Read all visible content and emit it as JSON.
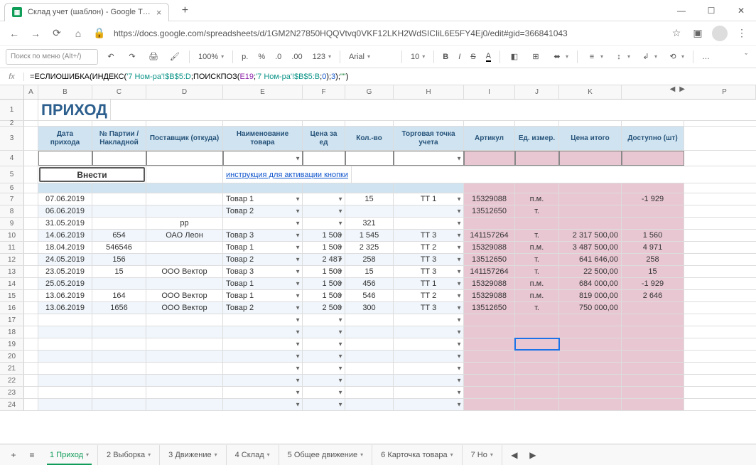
{
  "browser": {
    "tab_title": "Склад учет (шаблон) - Google Т…",
    "url": "https://docs.google.com/spreadsheets/d/1GM2N27850HQQVtvq0VKF12LKH2WdSICIiL6E5FY4Ej0/edit#gid=366841043"
  },
  "toolbar": {
    "search_ph": "Поиск по меню (Alt+/)",
    "zoom": "100%",
    "currency": "р.",
    "percent": "%",
    "dec_dec": ".0",
    "dec_inc": ".00",
    "num_fmt": "123",
    "font": "Arial",
    "font_size": "10"
  },
  "formula": {
    "prefix": "=",
    "fn1": "ЕСЛИОШИБКА",
    "fn2": "ИНДЕКС",
    "range1": "'7 Ном-ра'!$B$5:D",
    "fn3": "ПОИСКПОЗ",
    "ref": "E19",
    "range2": "'7 Ном-ра'!$B$5:B",
    "arg0": "0",
    "arg3": "3",
    "empty": "\"\""
  },
  "sheet": {
    "title": "ПРИХОД",
    "btn_enter": "Внести",
    "instr": "инструкция для активации кнопки",
    "cols": [
      "A",
      "B",
      "C",
      "D",
      "E",
      "F",
      "G",
      "H",
      "I",
      "J",
      "K",
      "P"
    ],
    "headers": {
      "B": "Дата прихода",
      "C": "№ Партии / Накладной",
      "D": "Поставщик (откуда)",
      "E": "Наименование товара",
      "F": "Цена за ед",
      "G": "Кол.-во",
      "H": "Торговая точка учета",
      "I": "Артикул",
      "J": "Ед. измер.",
      "K": "Цена итого",
      "P": "Доступно (шт)"
    },
    "rows": [
      {
        "n": "7",
        "B": "07.06.2019",
        "C": "",
        "D": "",
        "E": "Товар 1",
        "F": "",
        "G": "15",
        "H": "ТТ 1",
        "I": "15329088",
        "J": "п.м.",
        "K": "",
        "P": "-1 929"
      },
      {
        "n": "8",
        "B": "06.06.2019",
        "C": "",
        "D": "",
        "E": "Товар 2",
        "F": "",
        "G": "",
        "H": "",
        "I": "13512650",
        "J": "т.",
        "K": "",
        "P": ""
      },
      {
        "n": "9",
        "B": "31.05.2019",
        "C": "",
        "D": "рр",
        "E": "",
        "F": "",
        "G": "321",
        "H": "",
        "I": "",
        "J": "",
        "K": "",
        "P": ""
      },
      {
        "n": "10",
        "B": "14.06.2019",
        "C": "654",
        "D": "ОАО Леон",
        "E": "Товар 3",
        "F": "1 500",
        "G": "1 545",
        "H": "ТТ 3",
        "I": "141157264",
        "J": "т.",
        "K": "2 317 500,00",
        "P": "1 560"
      },
      {
        "n": "11",
        "B": "18.04.2019",
        "C": "546546",
        "D": "",
        "E": "Товар 1",
        "F": "1 500",
        "G": "2 325",
        "H": "ТТ 2",
        "I": "15329088",
        "J": "п.м.",
        "K": "3 487 500,00",
        "P": "4 971"
      },
      {
        "n": "12",
        "B": "24.05.2019",
        "C": "156",
        "D": "",
        "E": "Товар 2",
        "F": "2 487",
        "G": "258",
        "H": "ТТ 3",
        "I": "13512650",
        "J": "т.",
        "K": "641 646,00",
        "P": "258"
      },
      {
        "n": "13",
        "B": "23.05.2019",
        "C": "15",
        "D": "ООО Вектор",
        "E": "Товар 3",
        "F": "1 500",
        "G": "15",
        "H": "ТТ 3",
        "I": "141157264",
        "J": "т.",
        "K": "22 500,00",
        "P": "15"
      },
      {
        "n": "14",
        "B": "25.05.2019",
        "C": "",
        "D": "",
        "E": "Товар 1",
        "F": "1 500",
        "G": "456",
        "H": "ТТ 1",
        "I": "15329088",
        "J": "п.м.",
        "K": "684 000,00",
        "P": "-1 929"
      },
      {
        "n": "15",
        "B": "13.06.2019",
        "C": "164",
        "D": "ООО Вектор",
        "E": "Товар 1",
        "F": "1 500",
        "G": "546",
        "H": "ТТ 2",
        "I": "15329088",
        "J": "п.м.",
        "K": "819 000,00",
        "P": "2 646"
      },
      {
        "n": "16",
        "B": "13.06.2019",
        "C": "1656",
        "D": "ООО Вектор",
        "E": "Товар 2",
        "F": "2 500",
        "G": "300",
        "H": "ТТ 3",
        "I": "13512650",
        "J": "т.",
        "K": "750 000,00",
        "P": ""
      }
    ],
    "empty_rows": [
      "17",
      "18",
      "19",
      "20",
      "21",
      "22",
      "23",
      "24"
    ]
  },
  "tabs": {
    "items": [
      "1 Приход",
      "2 Выборка",
      "3 Движение",
      "4 Склад",
      "5 Общее движение",
      "6 Карточка товара",
      "7 Но"
    ],
    "active": 0
  }
}
